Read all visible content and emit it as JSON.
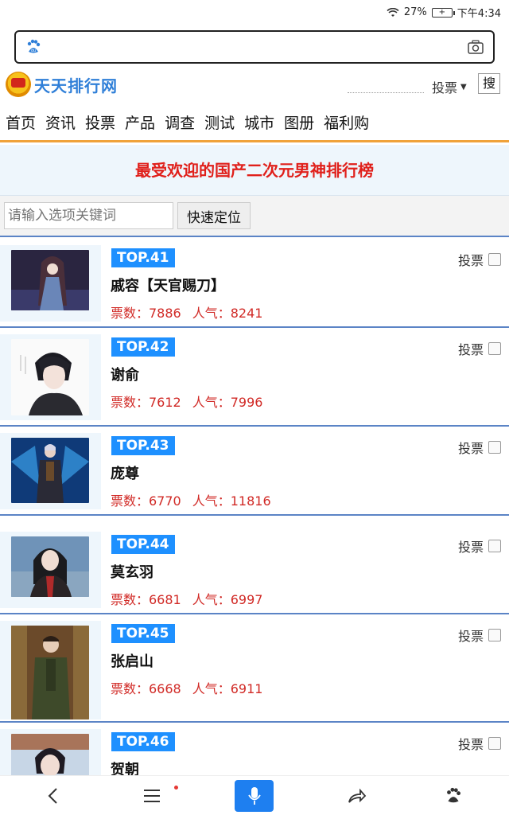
{
  "status": {
    "battery": "27%",
    "time": "下午4:34"
  },
  "search": {
    "placeholder": ""
  },
  "site": {
    "logo_text": "天天排行网",
    "select_label": "投票",
    "search_btn": "搜"
  },
  "nav": [
    "首页",
    "资讯",
    "投票",
    "产品",
    "调查",
    "测试",
    "城市",
    "图册",
    "福利购"
  ],
  "banner": {
    "title": "最受欢迎的国产二次元男神排行榜"
  },
  "filter": {
    "placeholder": "请输入选项关键词",
    "button": "快速定位"
  },
  "items": [
    {
      "rank": "TOP.41",
      "name": "戚容【天官赐刀】",
      "votes": "票数：7886",
      "pop": "人气：8241",
      "vote_label": "投票"
    },
    {
      "rank": "TOP.42",
      "name": "谢俞",
      "votes": "票数：7612",
      "pop": "人气：7996",
      "vote_label": "投票"
    },
    {
      "rank": "TOP.43",
      "name": "庞尊",
      "votes": "票数：6770",
      "pop": "人气：11816",
      "vote_label": "投票"
    },
    {
      "rank": "TOP.44",
      "name": "莫玄羽",
      "votes": "票数：6681",
      "pop": "人气：6997",
      "vote_label": "投票"
    },
    {
      "rank": "TOP.45",
      "name": "张启山",
      "votes": "票数：6668",
      "pop": "人气：6911",
      "vote_label": "投票"
    },
    {
      "rank": "TOP.46",
      "name": "贺朝",
      "votes": "",
      "pop": "",
      "vote_label": "投票"
    }
  ],
  "colors": {
    "accent": "#1e90ff",
    "red": "#d12a26",
    "rule": "#5b84c6"
  }
}
